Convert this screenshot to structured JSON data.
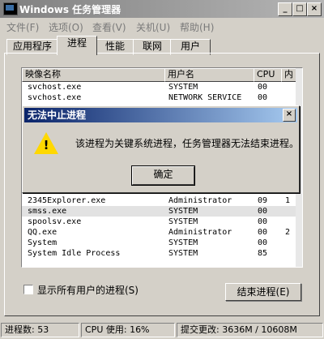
{
  "window": {
    "title": "Windows 任务管理器",
    "minimize": "_",
    "maximize": "□",
    "close": "×"
  },
  "menu": [
    "文件(F)",
    "选项(O)",
    "查看(V)",
    "关机(U)",
    "帮助(H)"
  ],
  "tabs": [
    "应用程序",
    "进程",
    "性能",
    "联网",
    "用户"
  ],
  "active_tab": "进程",
  "columns": [
    "映像名称",
    "用户名",
    "CPU",
    "内"
  ],
  "rows_top": [
    [
      "svchost.exe",
      "SYSTEM",
      "00",
      ""
    ],
    [
      "svchost.exe",
      "NETWORK SERVICE",
      "00",
      ""
    ]
  ],
  "rows_bottom": [
    [
      "2345Explorer.exe",
      "Administrator",
      "09",
      "1"
    ],
    [
      "smss.exe",
      "SYSTEM",
      "00",
      ""
    ],
    [
      "spoolsv.exe",
      "SYSTEM",
      "00",
      ""
    ],
    [
      "QQ.exe",
      "Administrator",
      "00",
      "2"
    ],
    [
      "System",
      "SYSTEM",
      "00",
      ""
    ],
    [
      "System Idle Process",
      "SYSTEM",
      "85",
      ""
    ]
  ],
  "dialog": {
    "title": "无法中止进程",
    "message": "该进程为关键系统进程，任务管理器无法结束进程。",
    "ok": "确定",
    "close": "×"
  },
  "show_all_users": "显示所有用户的进程(S)",
  "end_process": "结束进程(E)",
  "status": {
    "processes": "进程数: 53",
    "cpu": "CPU 使用: 16%",
    "commit": "提交更改: 3636M / 10608M"
  }
}
